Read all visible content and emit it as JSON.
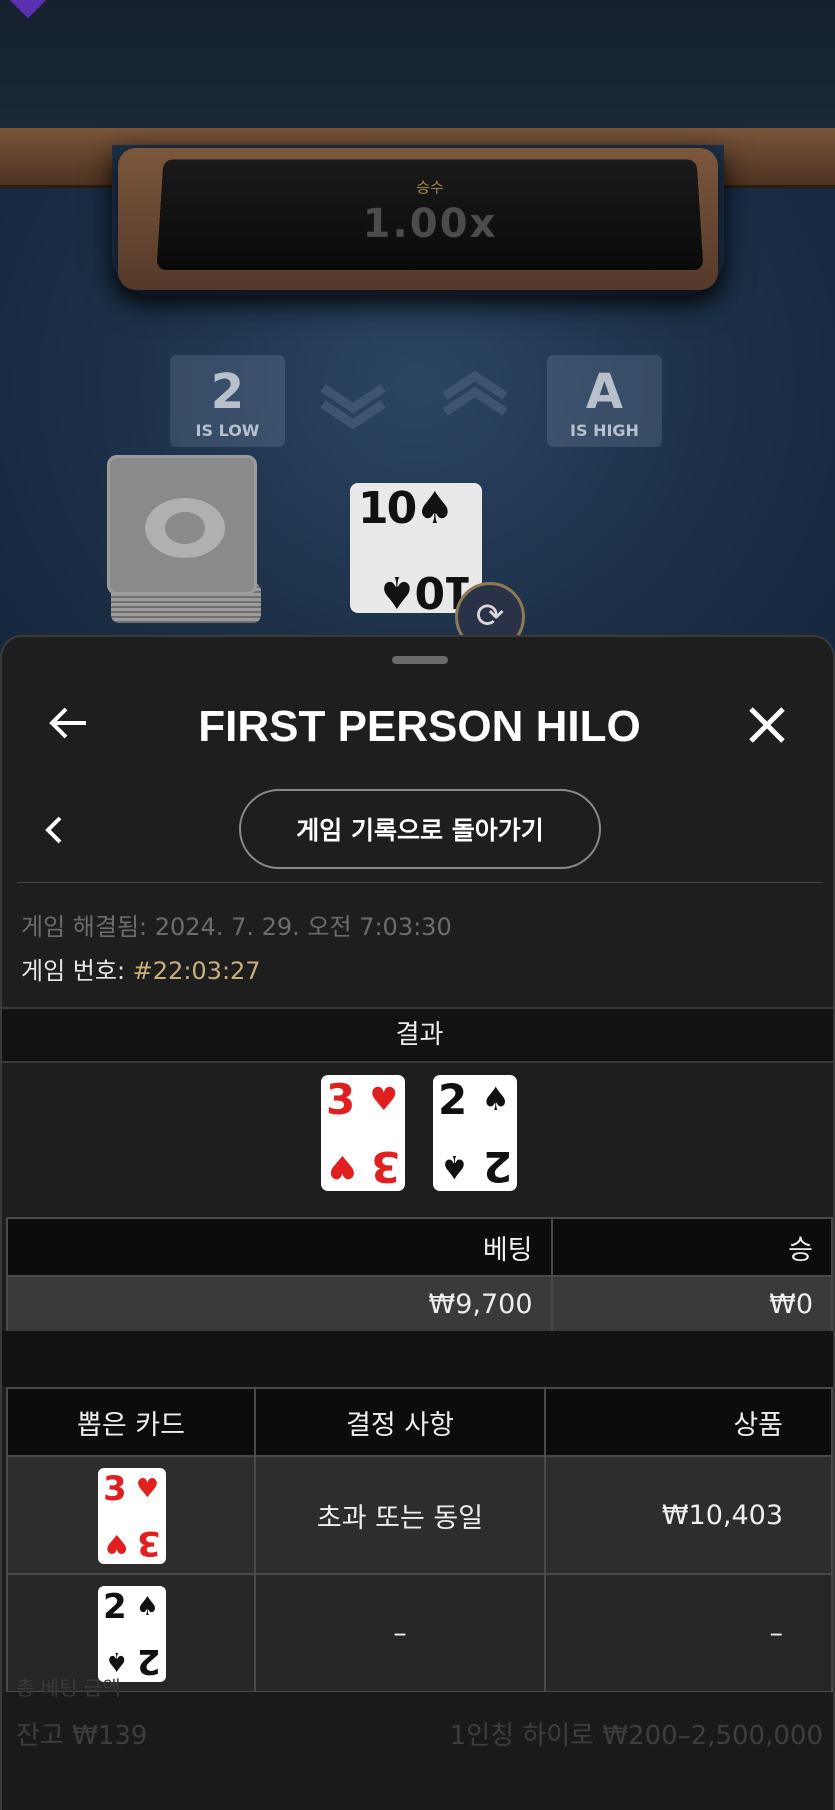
{
  "game_table": {
    "multiplier_label": "승수",
    "multiplier_value": "1.00x",
    "low_hint": {
      "rank": "2",
      "text": "IS LOW"
    },
    "high_hint": {
      "rank": "A",
      "text": "IS HIGH"
    },
    "current_card": {
      "rank": "10",
      "suit": "♠"
    }
  },
  "sheet": {
    "title": "FIRST PERSON HILO",
    "back_to_history_label": "게임 기록으로 돌아가기",
    "resolved_text": "게임 해결됨: 2024. 7. 29. 오전 7:03:30",
    "game_number_label": "게임 번호: ",
    "game_number_value": "#22:03:27",
    "result_header": "결과",
    "result_cards": [
      {
        "rank": "3",
        "suit": "♥",
        "color": "#e0201f"
      },
      {
        "rank": "2",
        "suit": "♠",
        "color": "#111111"
      }
    ],
    "bet_table": {
      "headers": [
        "베팅",
        "승"
      ],
      "values": [
        "₩9,700",
        "₩0"
      ]
    },
    "cards_table": {
      "headers": [
        "뽑은 카드",
        "결정 사항",
        "상품"
      ],
      "rows": [
        {
          "card": {
            "rank": "3",
            "suit": "♥"
          },
          "decision": "초과 또는 동일",
          "prize": "₩10,403"
        },
        {
          "card": {
            "rank": "2",
            "suit": "♠"
          },
          "decision": "–",
          "prize": "–"
        }
      ]
    },
    "background_faded": {
      "label": "총 베팅 금액",
      "left": "잔고 ₩139",
      "right": "1인칭 하이로 ₩200–2,500,000"
    }
  }
}
